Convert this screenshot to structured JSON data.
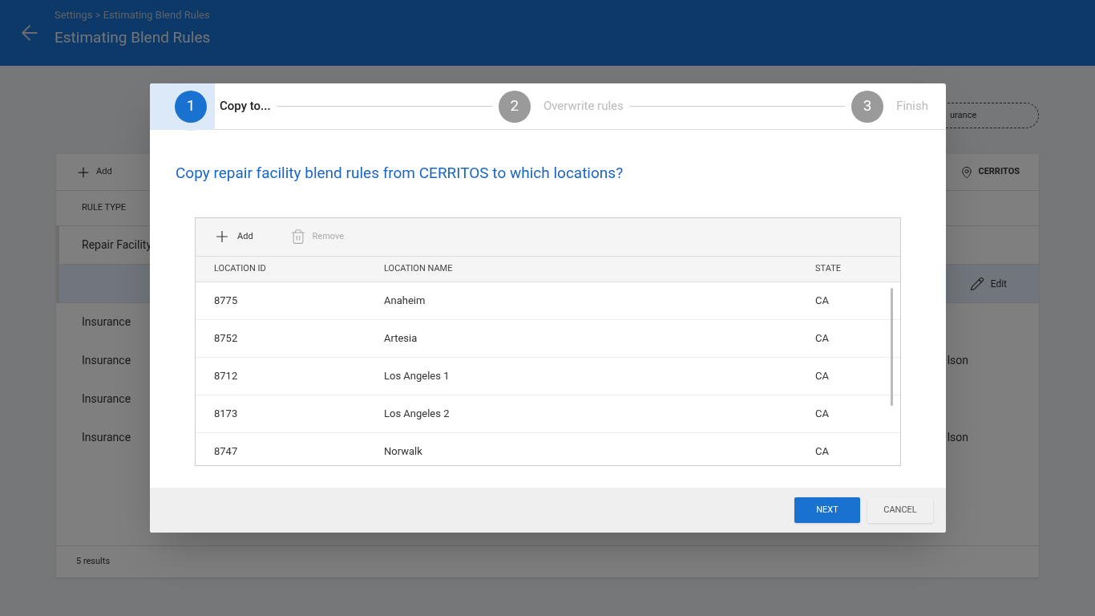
{
  "header": {
    "breadcrumb": "Settings > Estimating Blend Rules",
    "title": "Estimating Blend Rules"
  },
  "filter_chip": {
    "text": "urance"
  },
  "rules_table": {
    "toolbar": {
      "add": "Add",
      "location": "CERRITOS"
    },
    "columns": [
      "RULE TYPE"
    ],
    "rows": [
      {
        "kind": "group",
        "rule_type": "Repair Facility"
      },
      {
        "kind": "detail",
        "action": "Edit"
      },
      {
        "kind": "item",
        "rule_type": "Insurance"
      },
      {
        "kind": "item",
        "rule_type": "Insurance",
        "column_2": "lson"
      },
      {
        "kind": "item",
        "rule_type": "Insurance"
      },
      {
        "kind": "item",
        "rule_type": "Insurance",
        "column_2": "lson"
      }
    ],
    "footer": "5 results"
  },
  "dialog": {
    "steps": [
      {
        "number": "1",
        "label": "Copy to...",
        "selected": true
      },
      {
        "number": "2",
        "label": "Overwrite rules",
        "selected": false
      },
      {
        "number": "3",
        "label": "Finish",
        "selected": false
      }
    ],
    "question": "Copy repair facility blend rules from CERRITOS to which locations?",
    "toolbar": [
      {
        "kind": "add",
        "label": "Add",
        "disabled": false
      },
      {
        "kind": "remove",
        "label": "Remove",
        "disabled": true
      }
    ],
    "columns": [
      "LOCATION ID",
      "LOCATION NAME",
      "STATE"
    ],
    "rows": [
      {
        "id": "8775",
        "name": "Anaheim",
        "state": "CA"
      },
      {
        "id": "8752",
        "name": "Artesia",
        "state": "CA"
      },
      {
        "id": "8712",
        "name": "Los Angeles 1",
        "state": "CA"
      },
      {
        "id": "8173",
        "name": "Los Angeles 2",
        "state": "CA"
      },
      {
        "id": "8747",
        "name": "Norwalk",
        "state": "CA"
      }
    ],
    "buttons": [
      {
        "kind": "primary",
        "label": "NEXT"
      },
      {
        "kind": "secondary",
        "label": "CANCEL"
      }
    ]
  }
}
